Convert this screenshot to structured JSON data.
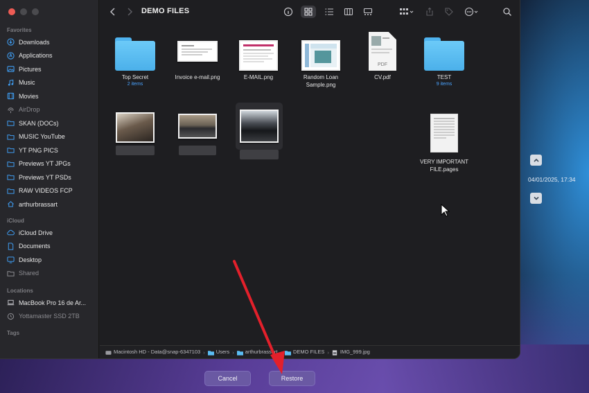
{
  "window": {
    "title": "DEMO FILES"
  },
  "sidebar": {
    "favorites_heading": "Favorites",
    "favorites": [
      {
        "label": "Downloads",
        "icon": "download-icon"
      },
      {
        "label": "Applications",
        "icon": "applications-icon"
      },
      {
        "label": "Pictures",
        "icon": "pictures-icon"
      },
      {
        "label": "Music",
        "icon": "music-icon"
      },
      {
        "label": "Movies",
        "icon": "movies-icon"
      },
      {
        "label": "AirDrop",
        "icon": "airdrop-icon"
      },
      {
        "label": "SKAN (DOCs)",
        "icon": "folder-icon"
      },
      {
        "label": "MUSIC YouTube",
        "icon": "folder-icon"
      },
      {
        "label": "YT PNG PICS",
        "icon": "folder-icon"
      },
      {
        "label": "Previews YT JPGs",
        "icon": "folder-icon"
      },
      {
        "label": "Previews YT PSDs",
        "icon": "folder-icon"
      },
      {
        "label": "RAW VIDEOS FCP",
        "icon": "folder-icon"
      },
      {
        "label": "arthurbrassart",
        "icon": "home-icon"
      }
    ],
    "icloud_heading": "iCloud",
    "icloud": [
      {
        "label": "iCloud Drive",
        "icon": "cloud-icon"
      },
      {
        "label": "Documents",
        "icon": "document-icon"
      },
      {
        "label": "Desktop",
        "icon": "desktop-icon"
      },
      {
        "label": "Shared",
        "icon": "shared-folder-icon"
      }
    ],
    "locations_heading": "Locations",
    "locations": [
      {
        "label": "MacBook Pro 16 de Ar...",
        "icon": "laptop-icon"
      },
      {
        "label": "Yottamaster SSD 2TB",
        "icon": "time-machine-icon"
      }
    ],
    "tags_heading": "Tags"
  },
  "files": [
    {
      "name": "Top Secret",
      "sub": "2 items",
      "kind": "folder"
    },
    {
      "name": "Invoice e-mail.png",
      "sub": "",
      "kind": "image"
    },
    {
      "name": "E-MAIL.png",
      "sub": "",
      "kind": "image"
    },
    {
      "name": "Random Loan Sample.png",
      "sub": "",
      "kind": "image"
    },
    {
      "name": "CV.pdf",
      "sub": "",
      "kind": "pdf"
    },
    {
      "name": "TEST",
      "sub": "9 items",
      "kind": "folder"
    },
    {
      "name": "VERY IMPORTANT FILE.pages",
      "sub": "",
      "kind": "pages"
    }
  ],
  "pdf_badge": "PDF",
  "pathbar": [
    {
      "label": "Macintosh HD - Data@snap-6347103",
      "icon": "disk-icon"
    },
    {
      "label": "Users",
      "icon": "folder-icon"
    },
    {
      "label": "arthurbrassart",
      "icon": "folder-icon"
    },
    {
      "label": "DEMO FILES",
      "icon": "folder-icon"
    },
    {
      "label": "IMG_999.jpg",
      "icon": "image-file-icon"
    }
  ],
  "pathbar_separator": "›",
  "timeline": {
    "date": "04/01/2025, 17:34"
  },
  "buttons": {
    "cancel": "Cancel",
    "restore": "Restore"
  },
  "colors": {
    "accent_folder": "#5bbdf4",
    "annotation_arrow": "#e3202b",
    "button_bg": "#6a59a3"
  }
}
